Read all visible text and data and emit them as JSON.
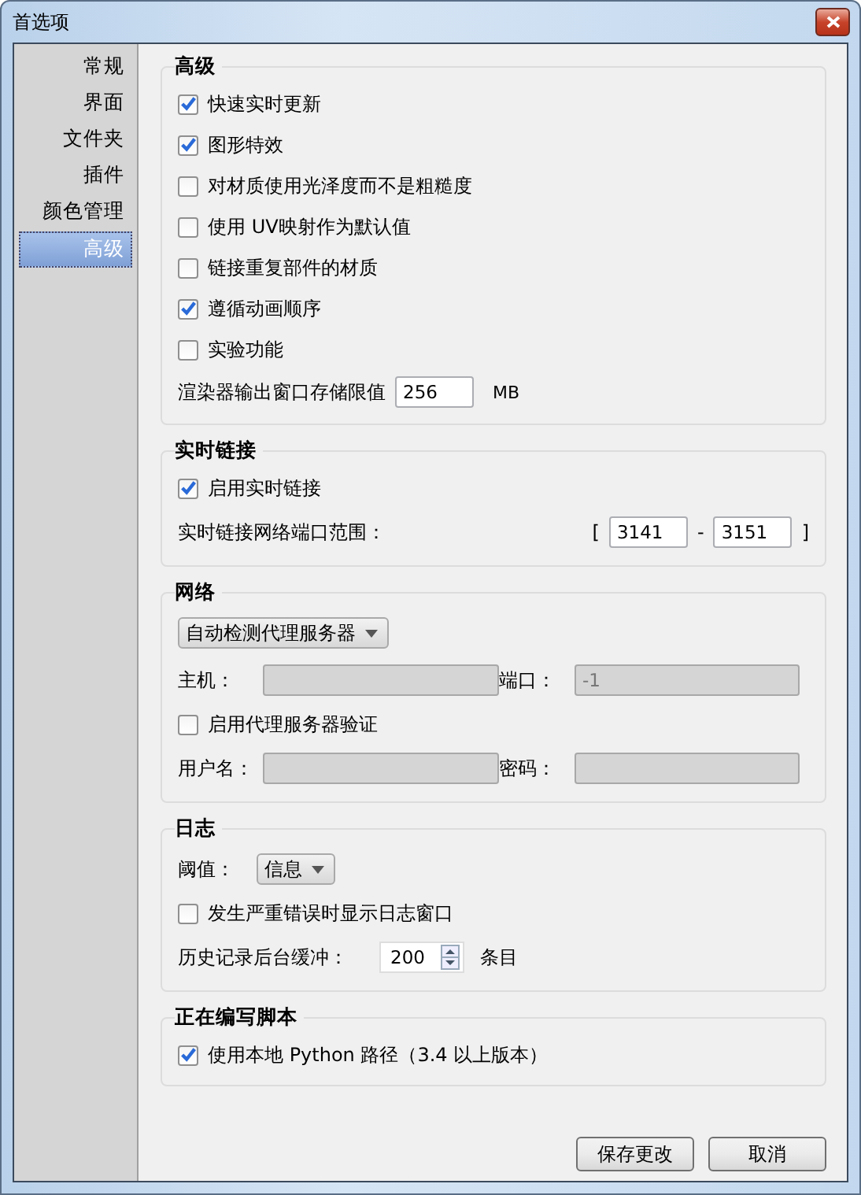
{
  "window": {
    "title": "首选项"
  },
  "sidebar": {
    "items": [
      {
        "label": "常规",
        "selected": false
      },
      {
        "label": "界面",
        "selected": false
      },
      {
        "label": "文件夹",
        "selected": false
      },
      {
        "label": "插件",
        "selected": false
      },
      {
        "label": "颜色管理",
        "selected": false
      },
      {
        "label": "高级",
        "selected": true
      }
    ]
  },
  "sections": [
    {
      "title": "高级",
      "rows": [
        {
          "kind": "checkbox",
          "label": "快速实时更新",
          "checked": true
        },
        {
          "kind": "checkbox",
          "label": "图形特效",
          "checked": true
        },
        {
          "kind": "checkbox",
          "label": "对材质使用光泽度而不是粗糙度",
          "checked": false
        },
        {
          "kind": "checkbox",
          "label": "使用 UV映射作为默认值",
          "checked": false
        },
        {
          "kind": "checkbox",
          "label": "链接重复部件的材质",
          "checked": false
        },
        {
          "kind": "checkbox",
          "label": "遵循动画顺序",
          "checked": true
        },
        {
          "kind": "checkbox",
          "label": "实验功能",
          "checked": false
        },
        {
          "kind": "number",
          "label": "渲染器输出窗口存储限值",
          "value": "256",
          "unit": "MB"
        }
      ]
    },
    {
      "title": "实时链接",
      "rows": [
        {
          "kind": "checkbox",
          "label": "启用实时链接",
          "checked": true
        },
        {
          "kind": "range",
          "label": "实时链接网络端口范围：",
          "open": "[",
          "from": "3141",
          "separator": "-",
          "to": "3151",
          "close": "]"
        }
      ]
    },
    {
      "title": "网络",
      "rows": [
        {
          "kind": "dropdown",
          "value": "自动检测代理服务器"
        },
        {
          "kind": "pair",
          "fields": [
            {
              "label": "主机：",
              "disabled": true
            },
            {
              "label": "端口：",
              "value": "-1",
              "disabled": true
            }
          ]
        },
        {
          "kind": "checkbox",
          "label": "启用代理服务器验证",
          "checked": false
        },
        {
          "kind": "pair",
          "fields": [
            {
              "label": "用户名：",
              "disabled": true
            },
            {
              "label": "密码：",
              "disabled": true
            }
          ]
        }
      ]
    },
    {
      "title": "日志",
      "rows": [
        {
          "kind": "dropdown",
          "label": "阈值：",
          "value": "信息"
        },
        {
          "kind": "checkbox",
          "label": "发生严重错误时显示日志窗口",
          "checked": false
        },
        {
          "kind": "spin",
          "label": "历史记录后台缓冲：",
          "value": "200",
          "unit": "条目"
        }
      ]
    },
    {
      "title": "正在编写脚本",
      "rows": [
        {
          "kind": "checkbox",
          "label": "使用本地 Python 路径（3.4 以上版本）",
          "checked": true
        }
      ]
    }
  ],
  "buttons": [
    {
      "label": "保存更改"
    },
    {
      "label": "取消"
    }
  ]
}
